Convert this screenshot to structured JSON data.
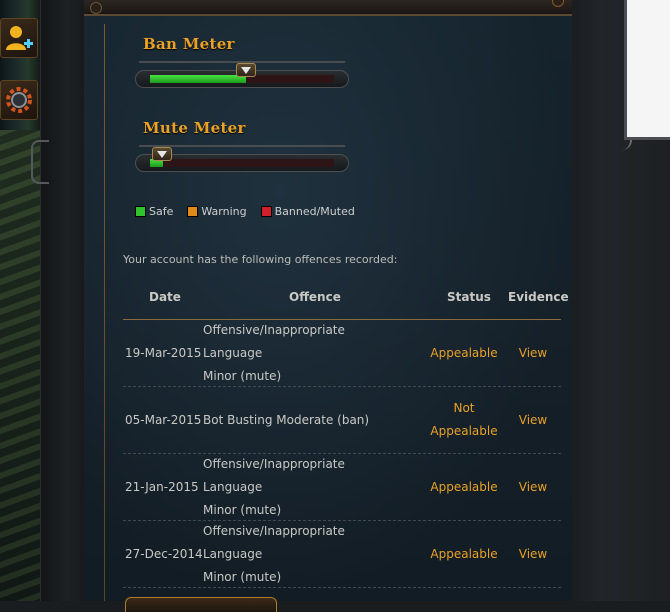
{
  "meters": {
    "ban": {
      "title": "Ban Meter",
      "level": 0.52
    },
    "mute": {
      "title": "Mute Meter",
      "level": 0.07
    }
  },
  "legend": [
    {
      "label": "Safe",
      "color": "#2fc42b"
    },
    {
      "label": "Warning",
      "color": "#e08a1c"
    },
    {
      "label": "Banned/Muted",
      "color": "#d0202a"
    }
  ],
  "offences": {
    "intro": "Your account has the following offences recorded:",
    "headers": {
      "date": "Date",
      "offence": "Offence",
      "status": "Status",
      "evidence": "Evidence"
    },
    "rows": [
      {
        "date": "19-Mar-2015",
        "offence_line1": "Offensive/Inappropriate Language",
        "offence_line2": "Minor (mute)",
        "status_line1": "Appealable",
        "status_line2": "",
        "evidence": "View"
      },
      {
        "date": "05-Mar-2015",
        "offence_line1": "Bot Busting Moderate (ban)",
        "offence_line2": "",
        "status_line1": "Not",
        "status_line2": "Appealable",
        "evidence": "View"
      },
      {
        "date": "21-Jan-2015",
        "offence_line1": "Offensive/Inappropriate Language",
        "offence_line2": "Minor (mute)",
        "status_line1": "Appealable",
        "status_line2": "",
        "evidence": "View"
      },
      {
        "date": "27-Dec-2014",
        "offence_line1": "Offensive/Inappropriate Language",
        "offence_line2": "Minor (mute)",
        "status_line1": "Appealable",
        "status_line2": "",
        "evidence": "View"
      }
    ]
  },
  "colors": {
    "accent": "#e9a126",
    "panel": "#15232c",
    "divider": "#8a6a3a"
  },
  "icons": {
    "side_top": "add-friend-icon",
    "side_bottom": "settings-cog-icon"
  }
}
